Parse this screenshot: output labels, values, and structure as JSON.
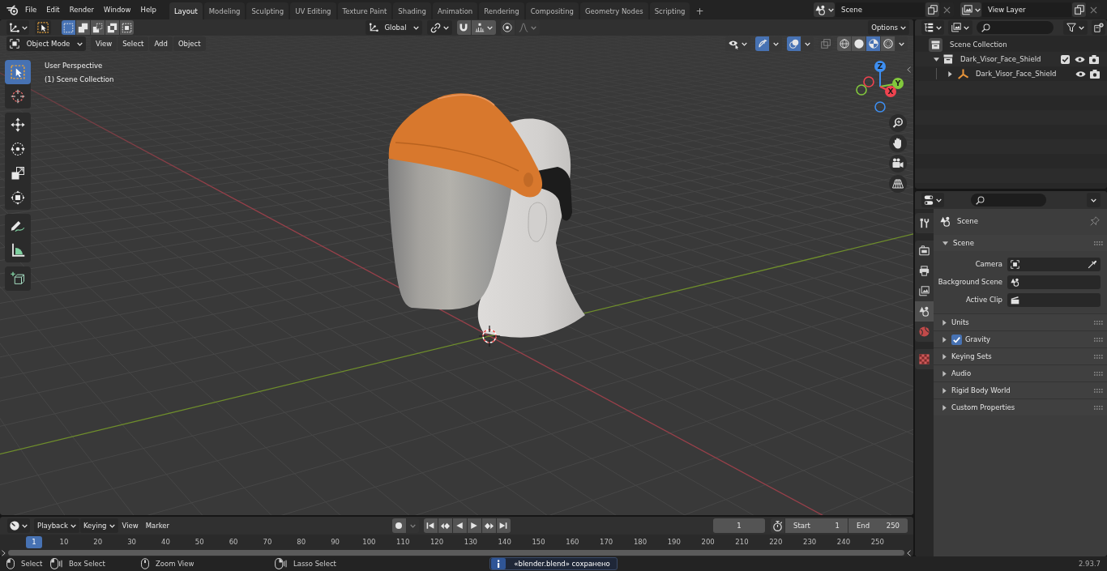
{
  "topbar": {
    "menus": [
      "File",
      "Edit",
      "Render",
      "Window",
      "Help"
    ],
    "workspaces": [
      {
        "label": "Layout",
        "selected": true
      },
      {
        "label": "Modeling",
        "selected": false
      },
      {
        "label": "Sculpting",
        "selected": false
      },
      {
        "label": "UV Editing",
        "selected": false
      },
      {
        "label": "Texture Paint",
        "selected": false
      },
      {
        "label": "Shading",
        "selected": false
      },
      {
        "label": "Animation",
        "selected": false
      },
      {
        "label": "Rendering",
        "selected": false
      },
      {
        "label": "Compositing",
        "selected": false
      },
      {
        "label": "Geometry Nodes",
        "selected": false
      },
      {
        "label": "Scripting",
        "selected": false
      }
    ],
    "add_workspace": "+",
    "scene": "Scene",
    "view_layer": "View Layer"
  },
  "viewport": {
    "tool_header": {
      "select_modes": [
        {
          "kind": "set",
          "selected": true
        },
        {
          "kind": "extend",
          "selected": false
        },
        {
          "kind": "subtract",
          "selected": false
        },
        {
          "kind": "difference",
          "selected": false
        },
        {
          "kind": "intersect",
          "selected": false
        }
      ],
      "orientation": "Global",
      "snap": {
        "on": false
      },
      "proportional_editing": {
        "on": false
      },
      "options": "Options"
    },
    "header": {
      "mode": "Object Mode",
      "menus": [
        "View",
        "Select",
        "Add",
        "Object"
      ],
      "gizmos": {
        "on": true
      },
      "overlays": {
        "on": true
      },
      "xray": {
        "on": false
      },
      "shading_modes": [
        {
          "kind": "wireframe",
          "selected": false
        },
        {
          "kind": "solid",
          "selected": false
        },
        {
          "kind": "material",
          "selected": true
        },
        {
          "kind": "rendered",
          "selected": false
        }
      ]
    },
    "view_name": "User Perspective",
    "collection_name": "(1) Scene Collection",
    "tool_groups": [
      [
        {
          "kind": "select-box",
          "selected": true
        },
        {
          "kind": "cursor",
          "selected": false
        }
      ],
      [
        {
          "kind": "move",
          "selected": false
        },
        {
          "kind": "rotate",
          "selected": false
        },
        {
          "kind": "scale",
          "selected": false
        },
        {
          "kind": "transform",
          "selected": false
        }
      ],
      [
        {
          "kind": "annotate",
          "selected": false
        },
        {
          "kind": "measure",
          "selected": false
        }
      ],
      [
        {
          "kind": "add-cube",
          "selected": false
        }
      ]
    ],
    "gizmo_axes": [
      {
        "kind": "z",
        "label": "Z",
        "color": "#3d8ef0"
      },
      {
        "kind": "y",
        "label": "Y",
        "color": "#82c83c"
      },
      {
        "kind": "x",
        "label": "X",
        "color": "#f0434f"
      }
    ]
  },
  "timeline": {
    "menus": [
      {
        "label": "Playback",
        "kind": "dropdown"
      },
      {
        "label": "Keying",
        "kind": "dropdown"
      },
      {
        "label": "View",
        "kind": "menu"
      },
      {
        "label": "Marker",
        "kind": "menu"
      }
    ],
    "auto_keying": {
      "on": false
    },
    "current_frame": "1",
    "preview_range": {
      "on": false
    },
    "start": {
      "label": "Start",
      "value": "1"
    },
    "end": {
      "label": "End",
      "value": "250"
    },
    "playhead": "1",
    "frame_labels": [
      "10",
      "20",
      "30",
      "40",
      "50",
      "60",
      "70",
      "80",
      "90",
      "100",
      "110",
      "120",
      "130",
      "140",
      "150",
      "160",
      "170",
      "180",
      "190",
      "200",
      "210",
      "220",
      "230",
      "240",
      "250"
    ]
  },
  "outliner": {
    "tree": [
      {
        "label": "Scene Collection",
        "kind": "scene-collection",
        "children": [
          {
            "label": "Dark_Visor_Face_Shield",
            "kind": "collection",
            "expanded": true,
            "checked": true,
            "visible": true,
            "renderable": true,
            "children": [
              {
                "label": "Dark_Visor_Face_Shield",
                "kind": "empty",
                "expanded": false,
                "visible": true,
                "renderable": true
              }
            ]
          }
        ]
      }
    ]
  },
  "properties": {
    "tab_groups": [
      [
        {
          "kind": "tool",
          "selected": false
        }
      ],
      [
        {
          "kind": "render",
          "selected": false
        },
        {
          "kind": "output",
          "selected": false
        },
        {
          "kind": "view-layer",
          "selected": false
        },
        {
          "kind": "scene",
          "selected": true
        },
        {
          "kind": "world",
          "selected": false
        }
      ],
      [
        {
          "kind": "texture",
          "selected": false
        }
      ]
    ],
    "context": "Scene",
    "panels": [
      {
        "title": "Scene",
        "expanded": true,
        "fields": [
          {
            "label": "Camera",
            "kind": "camera"
          },
          {
            "label": "Background Scene",
            "kind": "scene"
          },
          {
            "label": "Active Clip",
            "kind": "clip"
          }
        ]
      },
      {
        "title": "Units",
        "expanded": false
      },
      {
        "title": "Gravity",
        "expanded": false,
        "checkbox": {
          "checked": true
        }
      },
      {
        "title": "Keying Sets",
        "expanded": false
      },
      {
        "title": "Audio",
        "expanded": false
      },
      {
        "title": "Rigid Body World",
        "expanded": false
      },
      {
        "title": "Custom Properties",
        "expanded": false
      }
    ]
  },
  "status_bar": {
    "hints": [
      {
        "label": "Select",
        "kind": "click"
      },
      {
        "label": "Box Select",
        "kind": "drag"
      },
      {
        "label": "Zoom View",
        "kind": "middle"
      },
      {
        "label": "Lasso Select",
        "kind": "right-drag"
      }
    ],
    "report": "«blender.blend» сохранено",
    "version": "2.93.7"
  }
}
